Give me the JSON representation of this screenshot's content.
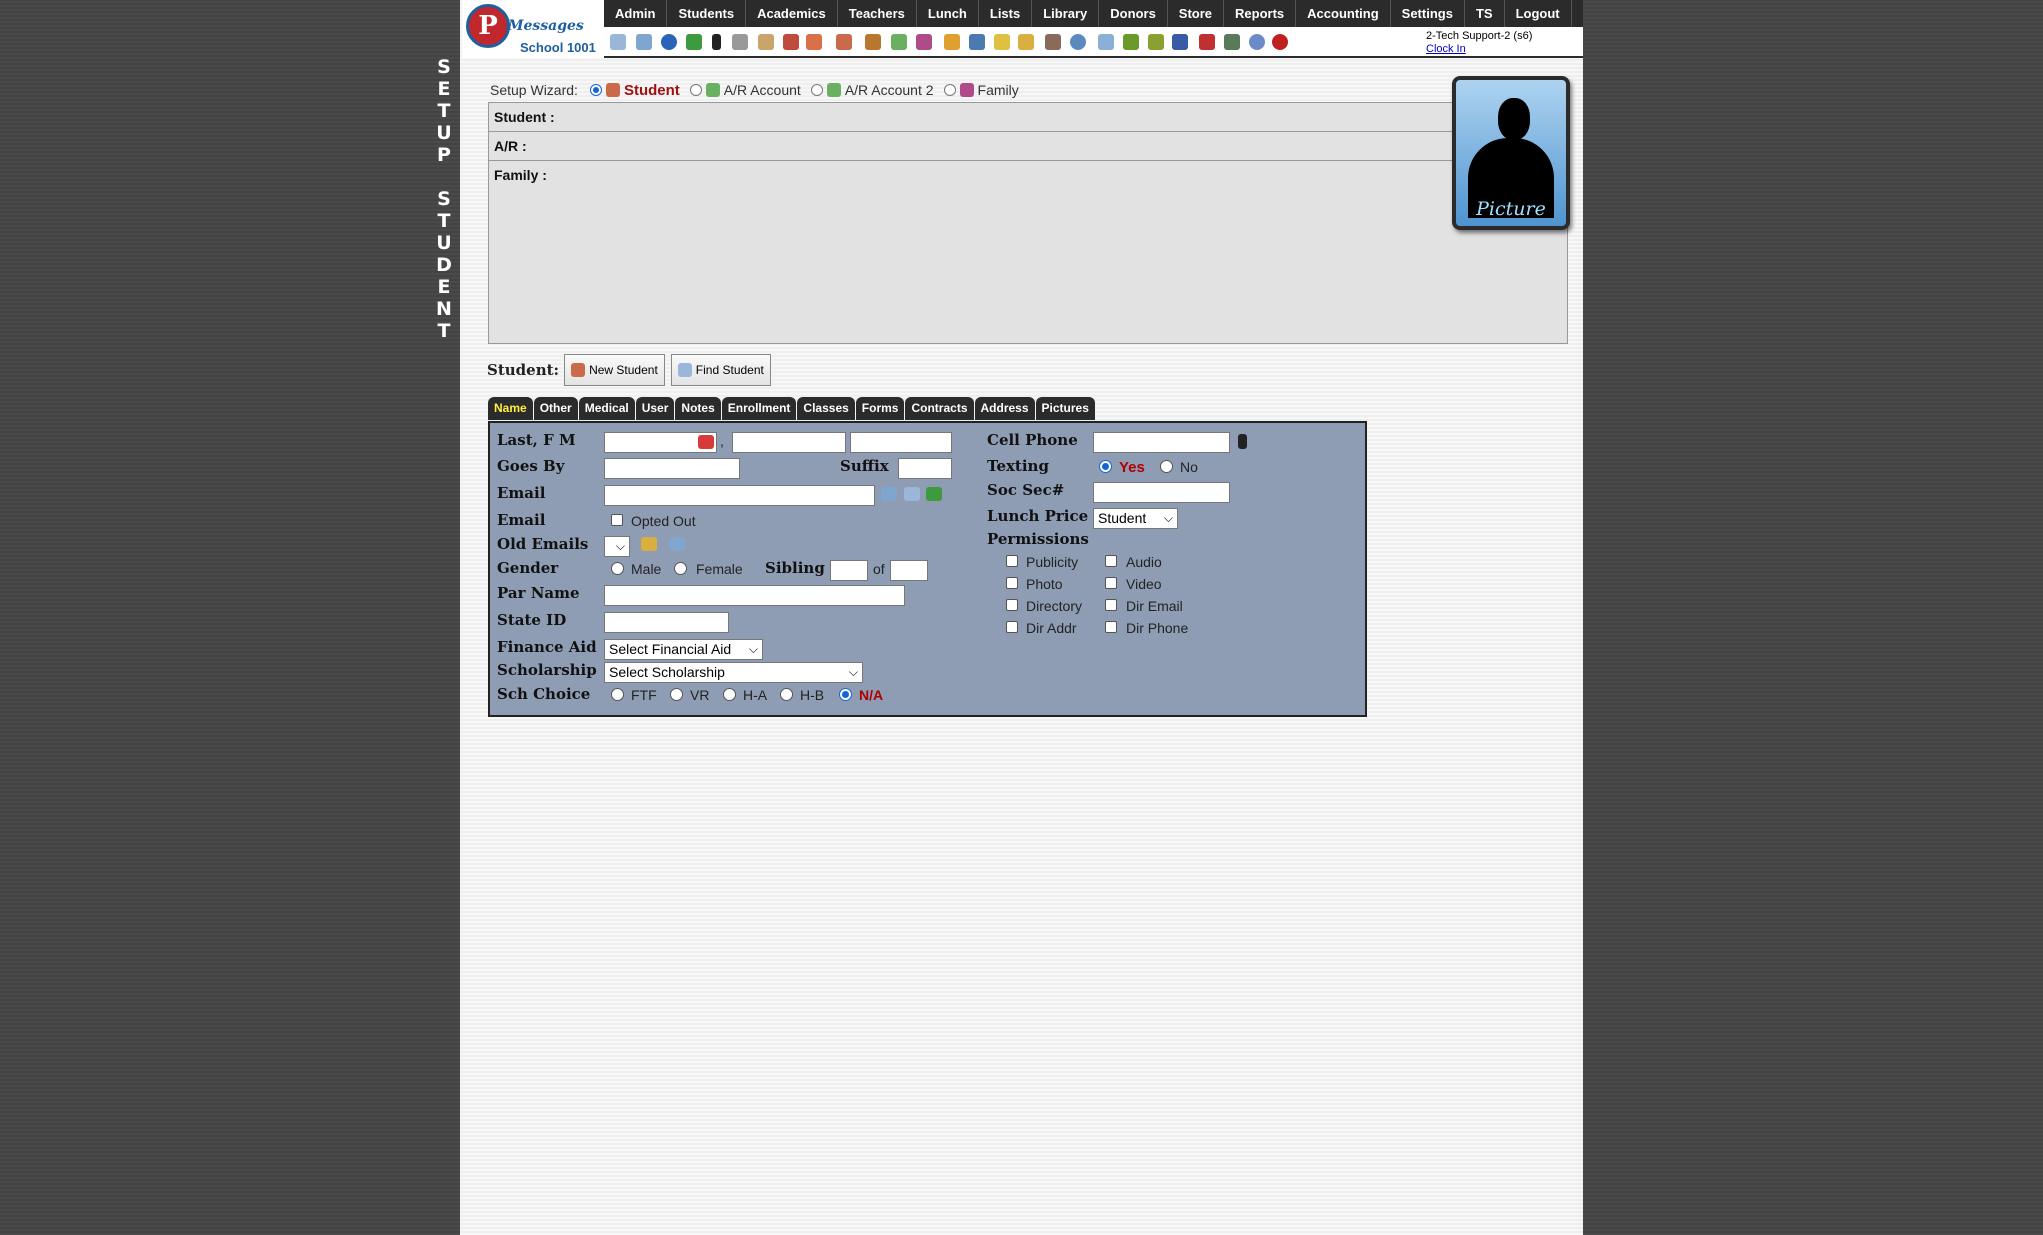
{
  "sidebar": {
    "vertical_title": "SETUP\n\nSTUDENT"
  },
  "header": {
    "logo_brand": "Messages",
    "logo_school": "School 1001",
    "menu": [
      "Admin",
      "Students",
      "Academics",
      "Teachers",
      "Lunch",
      "Lists",
      "Library",
      "Donors",
      "Store",
      "Reports",
      "Accounting",
      "Settings",
      "TS",
      "Logout"
    ],
    "user_line": "2-Tech Support-2 (s6)",
    "clock_in": "Clock In"
  },
  "wizard": {
    "label": "Setup Wizard:",
    "options": [
      {
        "label": "Student",
        "selected": true
      },
      {
        "label": "A/R Account",
        "selected": false
      },
      {
        "label": "A/R Account 2",
        "selected": false
      },
      {
        "label": "Family",
        "selected": false
      }
    ]
  },
  "summary": {
    "student": "Student :",
    "ar": "A/R :",
    "family": "Family :"
  },
  "picture_label": "Picture",
  "student_actions": {
    "label": "Student:",
    "new": "New Student",
    "find": "Find Student"
  },
  "tabs": [
    {
      "label": "Name",
      "active": true
    },
    {
      "label": "Other"
    },
    {
      "label": "Medical"
    },
    {
      "label": "User"
    },
    {
      "label": "Notes"
    },
    {
      "label": "Enrollment"
    },
    {
      "label": "Classes"
    },
    {
      "label": "Forms"
    },
    {
      "label": "Contracts"
    },
    {
      "label": "Address"
    },
    {
      "label": "Pictures"
    }
  ],
  "form": {
    "last_fm": "Last, F M",
    "comma": ",",
    "goes_by": "Goes By",
    "suffix": "Suffix",
    "email": "Email",
    "email_opt": "Email",
    "opted_out": "Opted Out",
    "old_emails": "Old Emails",
    "gender": "Gender",
    "male": "Male",
    "female": "Female",
    "sibling": "Sibling",
    "of": "of",
    "par_name": "Par Name",
    "state_id": "State ID",
    "finance_aid": "Finance Aid",
    "finance_aid_value": "Select Financial Aid",
    "scholarship": "Scholarship",
    "scholarship_value": "Select Scholarship",
    "sch_choice": "Sch Choice",
    "sch_options": [
      "FTF",
      "VR",
      "H-A",
      "H-B",
      "N/A"
    ],
    "cell_phone": "Cell Phone",
    "texting": "Texting",
    "yes": "Yes",
    "no": "No",
    "soc_sec": "Soc Sec#",
    "lunch_price": "Lunch Price",
    "lunch_price_value": "Student",
    "permissions": "Permissions",
    "perm_left": [
      "Publicity",
      "Photo",
      "Directory",
      "Dir Addr"
    ],
    "perm_right": [
      "Audio",
      "Video",
      "Dir Email",
      "Dir Phone"
    ]
  }
}
